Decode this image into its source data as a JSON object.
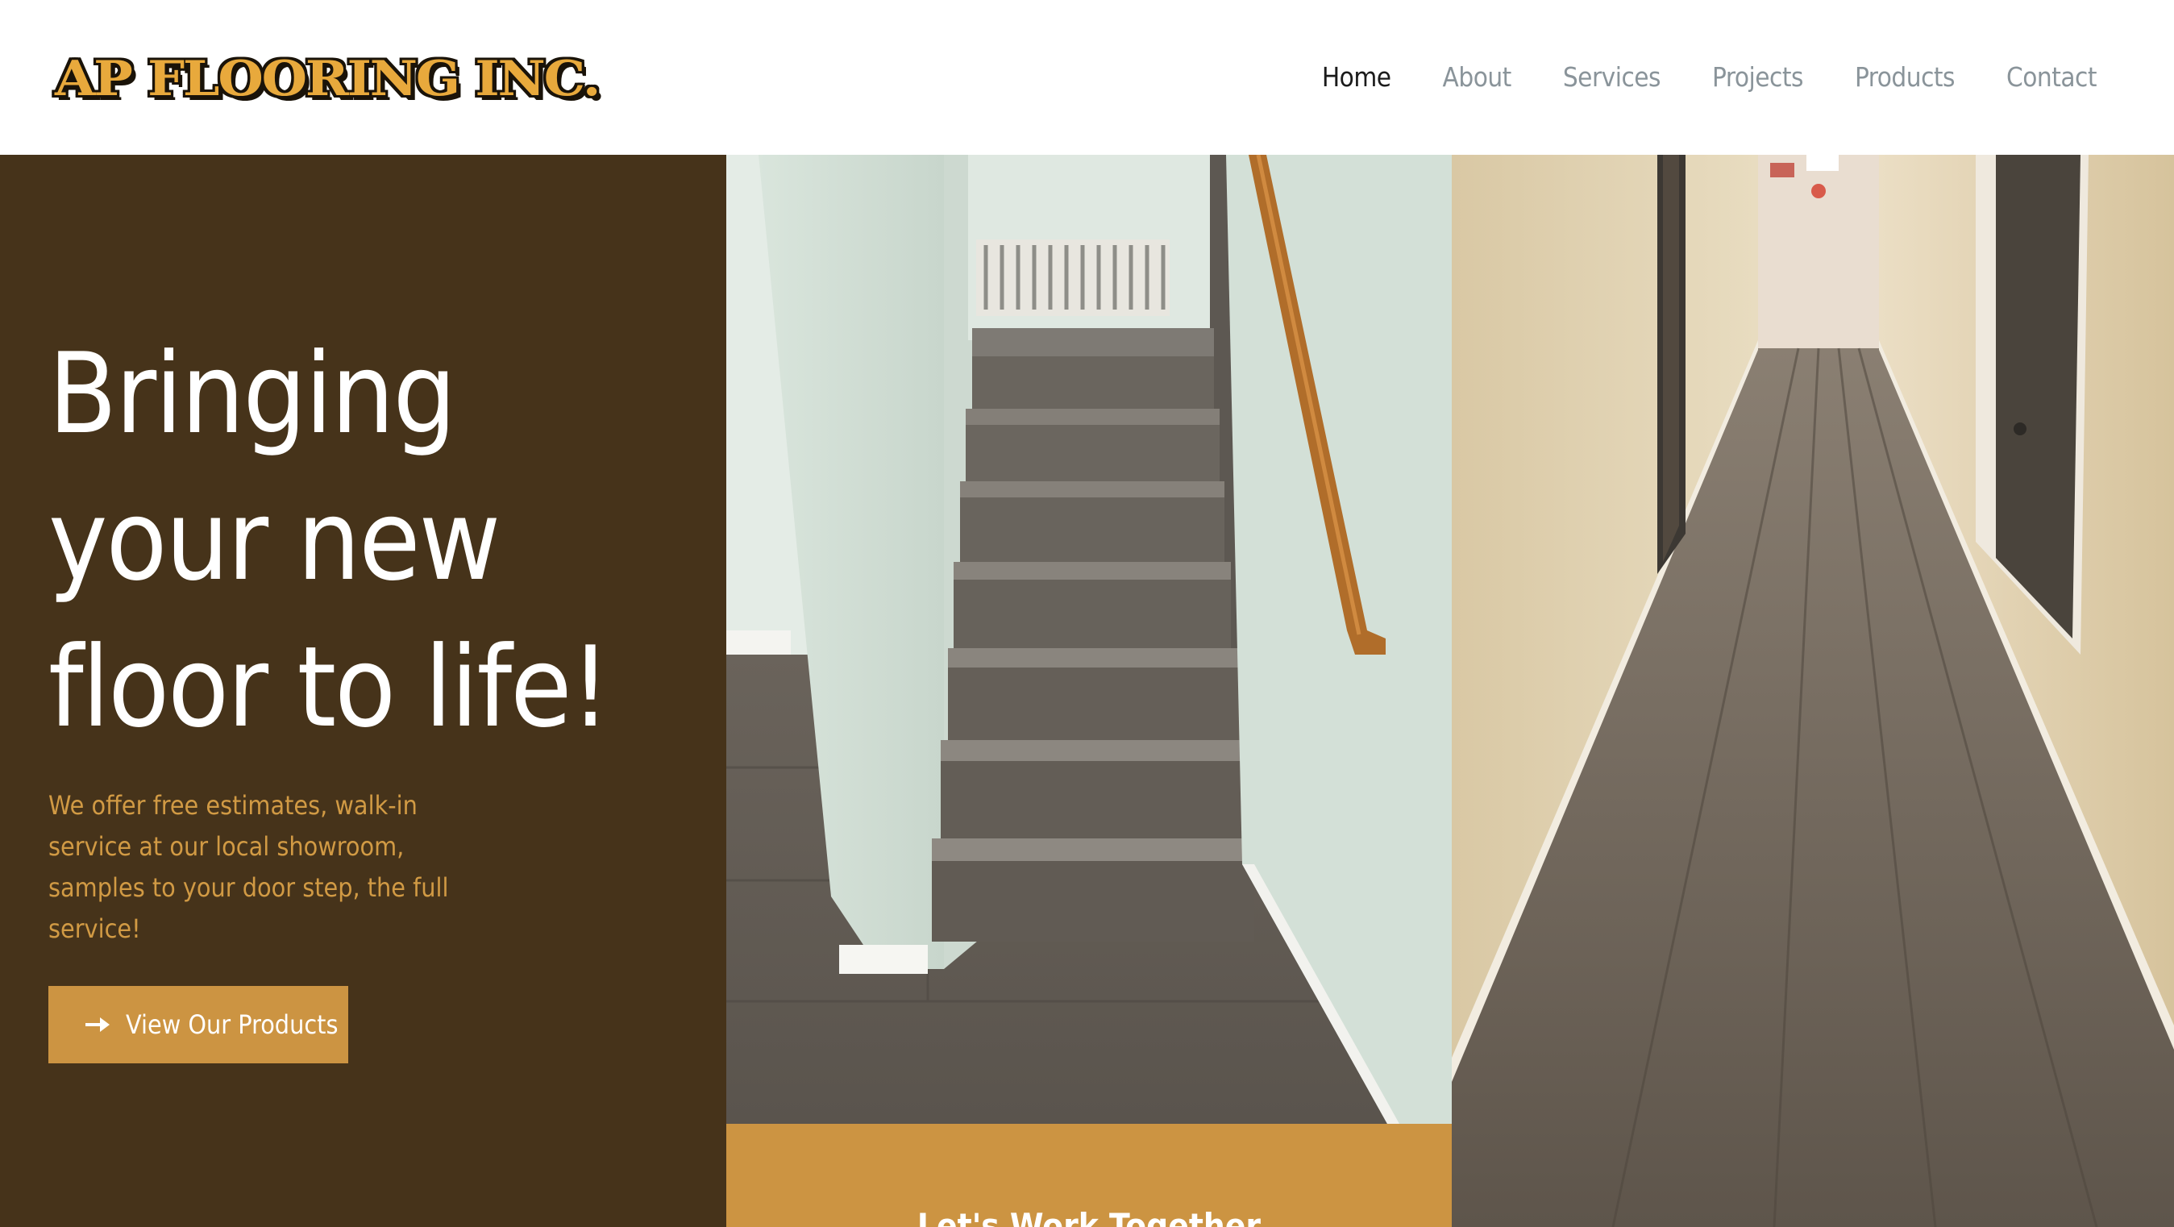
{
  "brand": {
    "logo_text": "AP FLOORING INC."
  },
  "nav": {
    "items": [
      {
        "label": "Home",
        "active": true
      },
      {
        "label": "About",
        "active": false
      },
      {
        "label": "Services",
        "active": false
      },
      {
        "label": "Projects",
        "active": false
      },
      {
        "label": "Products",
        "active": false
      },
      {
        "label": "Contact",
        "active": false
      }
    ]
  },
  "hero": {
    "title": "Bringing your new floor to life!",
    "subtitle": "We offer free estimates, walk-in service at our local showroom, samples to your door step, the full service!",
    "cta_label": "View Our Products",
    "cta_icon": "arrow-right-icon"
  },
  "work_panel": {
    "title": "Let's Work Together"
  },
  "colors": {
    "hero_bg": "#46331a",
    "accent": "#cc9442",
    "subtitle": "#d19a44",
    "nav_active": "#1b1b1b",
    "nav_inactive": "#8a949a",
    "logo_fill": "#e8a93c"
  }
}
